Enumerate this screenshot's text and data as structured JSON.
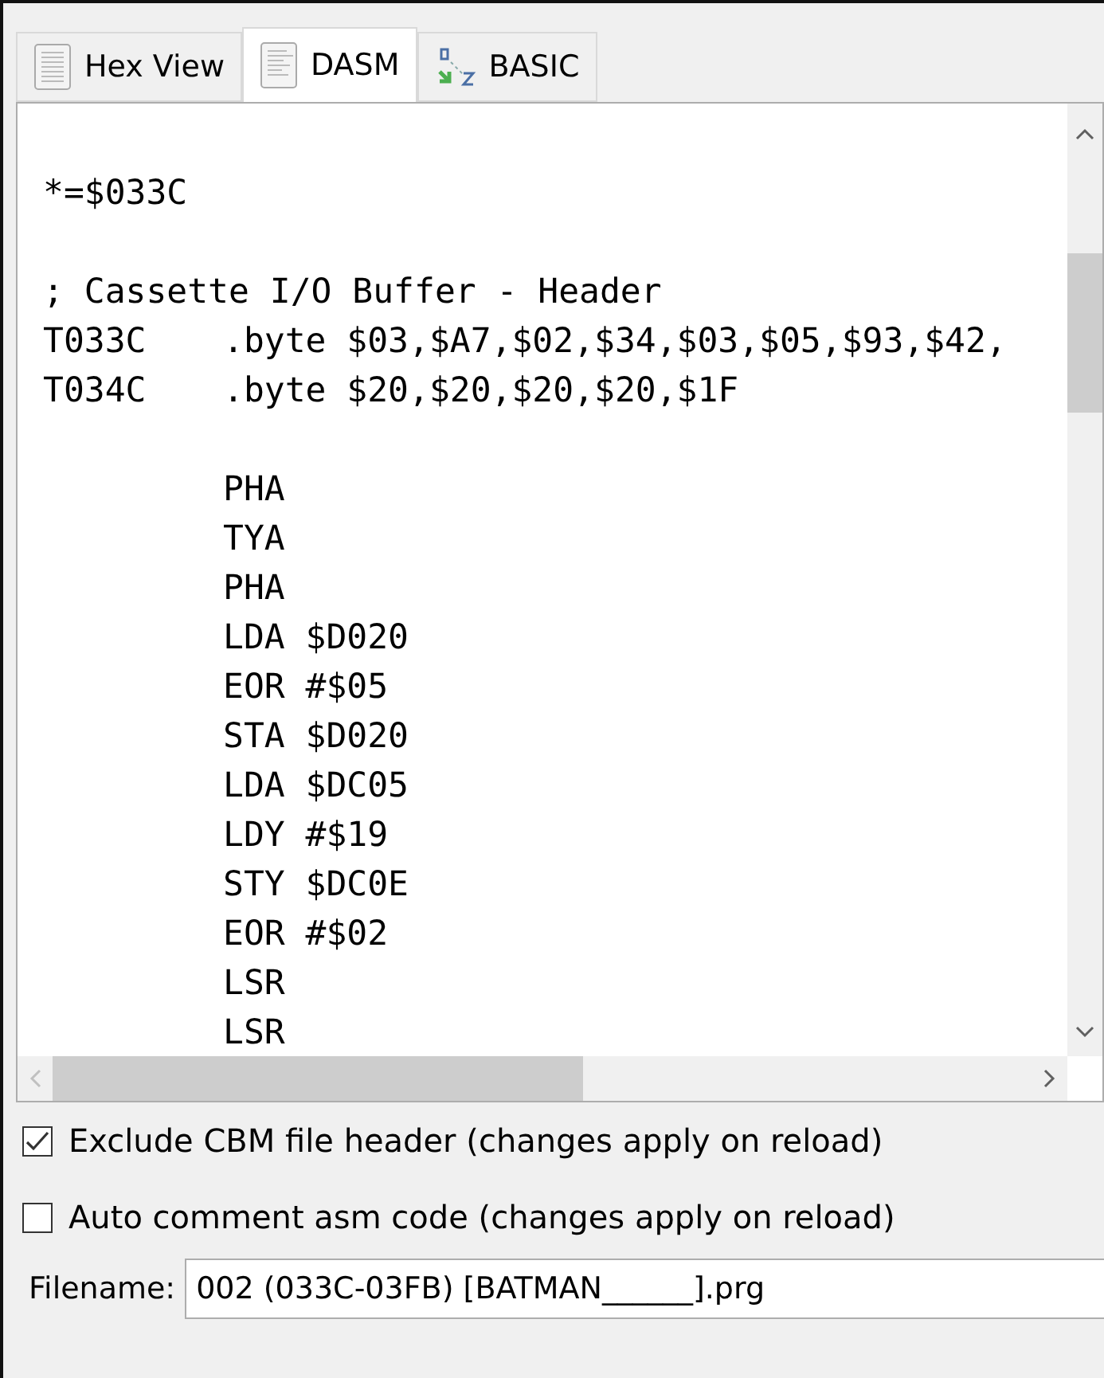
{
  "tabs": [
    {
      "label": "Hex View",
      "selected": false
    },
    {
      "label": "DASM",
      "selected": true
    },
    {
      "label": "BASIC",
      "selected": false
    }
  ],
  "code": [
    {
      "kind": "blank"
    },
    {
      "kind": "directive",
      "text": "*=$033C"
    },
    {
      "kind": "blank"
    },
    {
      "kind": "comment",
      "text": "; Cassette I/O Buffer - Header"
    },
    {
      "kind": "data",
      "label": "T033C",
      "text": ".byte $03,$A7,$02,$34,$03,$05,$93,$42,"
    },
    {
      "kind": "data",
      "label": "T034C",
      "text": ".byte $20,$20,$20,$20,$1F"
    },
    {
      "kind": "blank"
    },
    {
      "kind": "instruction",
      "text": "PHA"
    },
    {
      "kind": "instruction",
      "text": "TYA"
    },
    {
      "kind": "instruction",
      "text": "PHA"
    },
    {
      "kind": "instruction",
      "text": "LDA $D020"
    },
    {
      "kind": "instruction",
      "text": "EOR #$05"
    },
    {
      "kind": "instruction",
      "text": "STA $D020"
    },
    {
      "kind": "instruction",
      "text": "LDA $DC05"
    },
    {
      "kind": "instruction",
      "text": "LDY #$19"
    },
    {
      "kind": "instruction",
      "text": "STY $DC0E"
    },
    {
      "kind": "instruction",
      "text": "EOR #$02"
    },
    {
      "kind": "instruction",
      "text": "LSR"
    },
    {
      "kind": "instruction",
      "text": "LSR"
    }
  ],
  "options": [
    {
      "label": "Exclude CBM file header (changes apply on reload)",
      "checked": true
    },
    {
      "label": "Auto comment asm code (changes apply on reload)",
      "checked": false
    }
  ],
  "filename": {
    "label": "Filename:",
    "value": "002 (033C-03FB) [BATMAN______].prg"
  }
}
